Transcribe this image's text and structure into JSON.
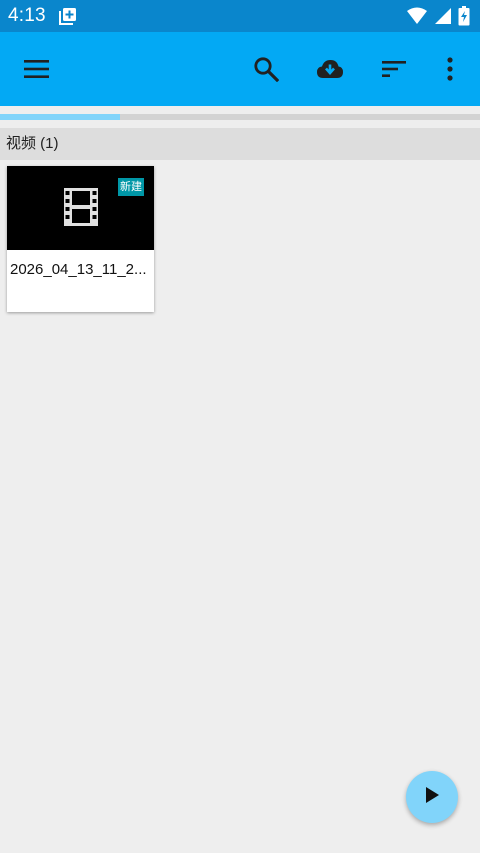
{
  "status_bar": {
    "time": "4:13",
    "icons": [
      "notification-add-icon",
      "wifi-icon",
      "signal-icon",
      "battery-charging-icon"
    ]
  },
  "app_bar": {
    "color": "#03a9f4",
    "actions": [
      "menu-icon",
      "search-icon",
      "cloud-download-icon",
      "sort-icon",
      "more-vert-icon"
    ]
  },
  "progress": {
    "value": 0.25
  },
  "section": {
    "title": "视频 (1)"
  },
  "items": [
    {
      "title": "2026_04_13_11_2...",
      "badge": "新建",
      "icon": "film-icon"
    }
  ],
  "fab": {
    "icon": "play-icon",
    "color": "#81d4fa"
  }
}
